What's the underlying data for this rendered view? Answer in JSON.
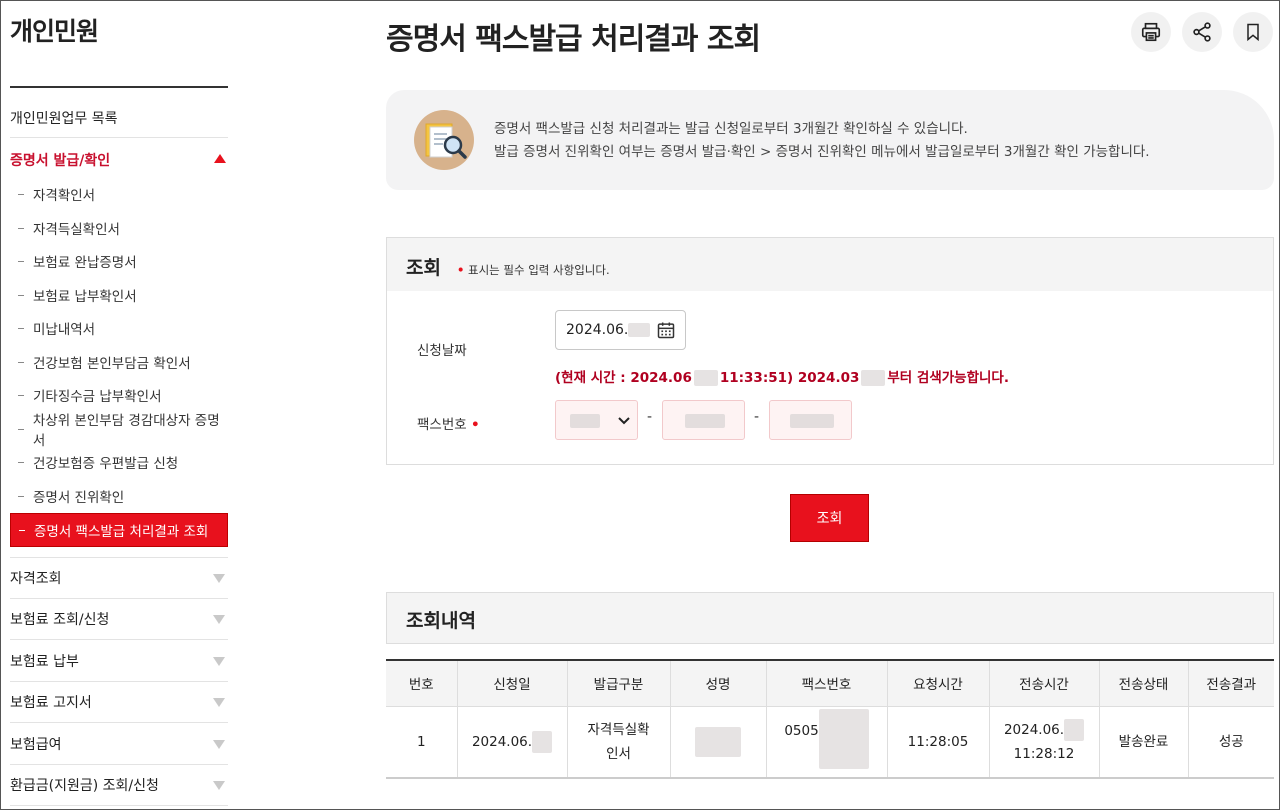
{
  "sidebar": {
    "title": "개인민원",
    "list_link": "개인민원업무 목록",
    "active_section": "증명서 발급/확인",
    "sub_items": [
      "자격확인서",
      "자격득실확인서",
      "보험료 완납증명서",
      "보험료 납부확인서",
      "미납내역서",
      "건강보험 본인부담금 확인서",
      "기타징수금 납부확인서",
      "차상위 본인부담 경감대상자 증명서",
      "건강보험증 우편발급 신청",
      "증명서 진위확인",
      "증명서 팩스발급 처리결과 조회"
    ],
    "categories": [
      "자격조회",
      "보험료 조회/신청",
      "보험료 납부",
      "보험료 고지서",
      "보험급여",
      "환급금(지원금) 조회/신청"
    ]
  },
  "header": {
    "title": "증명서 팩스발급 처리결과 조회",
    "buttons": [
      "printer-icon",
      "share-icon",
      "bookmark-icon"
    ]
  },
  "info": {
    "line1": "증명서 팩스발급 신청 처리결과는 발급 신청일로부터 3개월간 확인하실 수 있습니다.",
    "line2": "발급 증명서 진위확인 여부는 증명서 발급·확인 > 증명서 진위확인 메뉴에서 발급일로부터 3개월간 확인 가능합니다."
  },
  "search": {
    "heading": "조회",
    "required_note": "표시는 필수 입력 사항입니다.",
    "date_label": "신청날짜",
    "date_value": "2024.06.",
    "notice_part1": "(현재 시간 : 2024.06",
    "notice_part2": "11:33:51) 2024.03",
    "notice_part3": "부터 검색가능합니다.",
    "fax_label": "팩스번호",
    "fax_sep": "-",
    "button": "조회"
  },
  "results": {
    "heading": "조회내역",
    "columns": [
      "번호",
      "신청일",
      "발급구분",
      "성명",
      "팩스번호",
      "요청시간",
      "전송시간",
      "전송상태",
      "전송결과"
    ],
    "rows": [
      {
        "no": "1",
        "date": "2024.06.",
        "type": "자격득실확인서",
        "name": "",
        "fax": "0505",
        "request_time": "11:28:05",
        "send_date": "2024.06.",
        "send_time": "11:28:12",
        "status": "발송완료",
        "result": "성공"
      }
    ]
  },
  "colors": {
    "accent": "#e8111d",
    "notice": "#b00020",
    "panel_bg": "#f4f4f4"
  }
}
